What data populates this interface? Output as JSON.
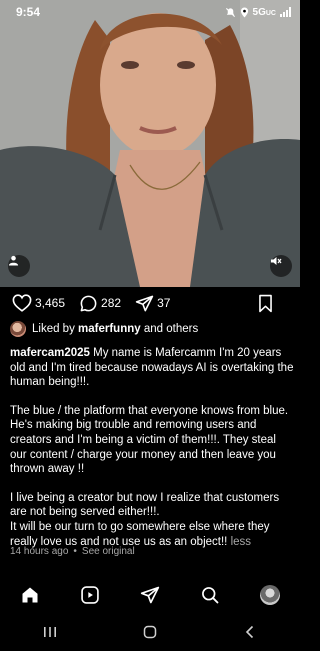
{
  "status_bar": {
    "time": "9:54",
    "network": "5G",
    "network_sub": "UC",
    "icons": [
      "mute-icon",
      "location-icon",
      "signal-icon"
    ]
  },
  "post": {
    "media_buttons": [
      "profile-icon",
      "mute-icon"
    ],
    "actions": {
      "likes_count": "3,465",
      "comments_count": "282",
      "shares_count": "37"
    },
    "liked_by": {
      "prefix": "Liked by ",
      "user": "maferfunny",
      "suffix": " and others"
    },
    "caption": {
      "username": "mafercam2025",
      "paragraph1": " My name is Mafercamm I'm 20 years old and I'm tired because nowadays AI is overtaking the human being!!!.",
      "paragraph2": "The blue / the platform that everyone knows from blue. He's making big trouble and removing users and creators and I'm being a victim of them!!!. They steal our content / charge your money and then leave you thrown away !!",
      "paragraph3a": "I live being a creator but now I realize that customers are not being served either!!!.",
      "paragraph3b": "It will be our turn to go somewhere else where they really love us and not use us as an object!!",
      "less": "less"
    },
    "time_ago": "14 hours ago",
    "separator": "•",
    "see_original": "See original"
  },
  "bottom_nav": [
    "home-icon",
    "reels-icon",
    "send-icon",
    "search-icon",
    "profile-avatar"
  ],
  "system_nav": [
    "recent-apps-icon",
    "home-button-icon",
    "back-icon"
  ]
}
